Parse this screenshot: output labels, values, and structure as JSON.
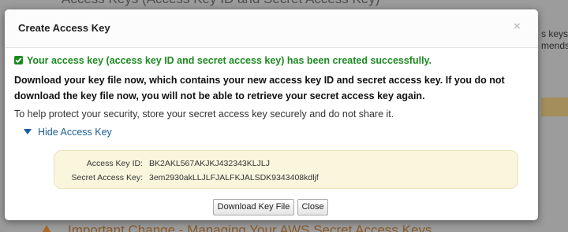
{
  "background": {
    "heading": "Access Keys (Access Key ID and Secret Access Key)",
    "side_text_lines": [
      "s keys",
      "mends"
    ],
    "bottom_heading": "Important Change - Managing Your AWS Secret Access Keys"
  },
  "dialog": {
    "title": "Create Access Key",
    "close_symbol": "×",
    "success_message": "Your access key (access key ID and secret access key) has been created successfully.",
    "download_warning": "Download your key file now, which contains your new access key ID and secret access key. If you do not download the key file now, you will not be able to retrieve your secret access key again.",
    "security_note": "To help protect your security, store your secret access key securely and do not share it.",
    "toggle_label": "Hide Access Key",
    "access_key_id_label": "Access Key ID:",
    "access_key_id_value": "BK2AKL567AKJKJ432343KLJLJ",
    "secret_key_label": "Secret Access Key:",
    "secret_key_value": "3em2930akLLJLFJALFKJALSDK9343408kdljf",
    "download_button": "Download Key File",
    "close_button": "Close"
  },
  "icons": {
    "success": "checkmark-icon",
    "toggle": "triangle-down-icon",
    "warning": "warning-icon"
  },
  "colors": {
    "success_green": "#1d8a22",
    "link_blue": "#1a5d9a",
    "key_box_bg": "#faf6dd",
    "overlay_gray": "#9c9c9c"
  }
}
